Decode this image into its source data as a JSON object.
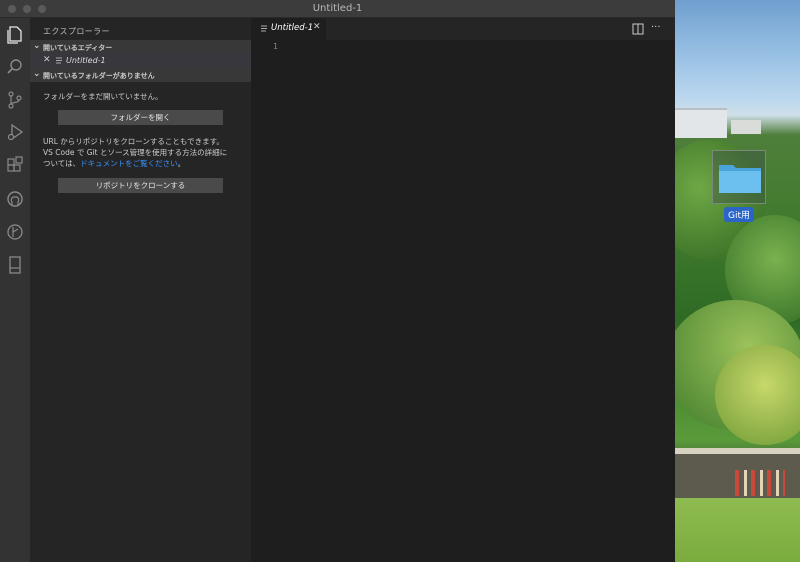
{
  "window": {
    "title": "Untitled-1"
  },
  "sidebar": {
    "title": "エクスプローラー",
    "open_editors_header": "開いているエディター",
    "open_editor_item": "Untitled-1",
    "no_folder_header": "開いているフォルダーがありません",
    "no_folder_message": "フォルダーをまだ開いていません。",
    "open_folder_button": "フォルダーを開く",
    "clone_message_line1": "URL からリポジトリをクローンすることもできます。",
    "clone_message_line2": "VS Code で Git とソース管理を使用する方法の詳細に",
    "clone_message_line3_prefix": "ついては、",
    "docs_link": "ドキュメントをご覧ください",
    "clone_message_line3_suffix": "。",
    "clone_button": "リポジトリをクローンする"
  },
  "editor": {
    "tab_label": "Untitled-1",
    "line_number": "1"
  },
  "desktop": {
    "folder_label": "Git用"
  },
  "activitybar": {
    "icons": [
      "files-icon",
      "search-icon",
      "source-control-icon",
      "run-debug-icon",
      "extensions-icon",
      "github-icon",
      "git-graph-icon",
      "notebook-icon"
    ]
  },
  "colors": {
    "accent_link": "#3794ff",
    "sidebar_bg": "#252526",
    "editor_bg": "#1e1e1e",
    "activitybar_bg": "#333333"
  }
}
